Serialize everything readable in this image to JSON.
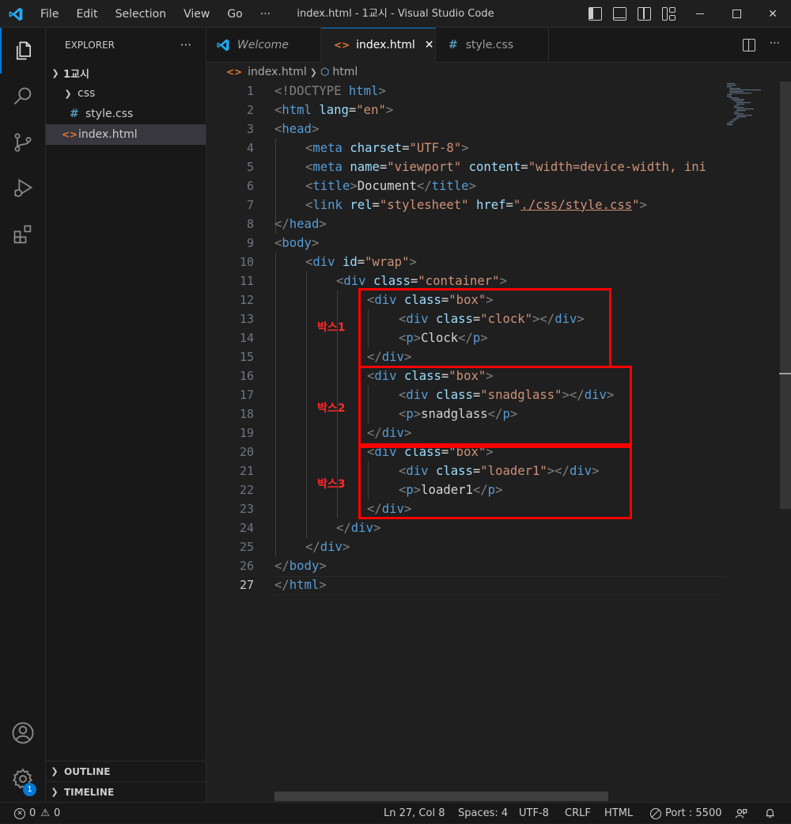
{
  "window": {
    "title": "index.html - 1교시 - Visual Studio Code"
  },
  "menu": [
    "File",
    "Edit",
    "Selection",
    "View",
    "Go",
    "···"
  ],
  "explorer": {
    "header": "EXPLORER",
    "more": "···",
    "root": "1교시",
    "folder": "css",
    "files": [
      "style.css",
      "index.html"
    ],
    "outline": "OUTLINE",
    "timeline": "TIMELINE"
  },
  "tabs": [
    {
      "label": "Welcome",
      "icon": "vscode-logo-icon"
    },
    {
      "label": "index.html",
      "icon": "html-file-icon",
      "close": "✕"
    },
    {
      "label": "style.css",
      "icon": "css-file-icon"
    }
  ],
  "editor_actions": {
    "more": "···"
  },
  "breadcrumb": {
    "file": "index.html",
    "symbol": "html"
  },
  "code_lines": [
    "1",
    "2",
    "3",
    "4",
    "5",
    "6",
    "7",
    "8",
    "9",
    "10",
    "11",
    "12",
    "13",
    "14",
    "15",
    "16",
    "17",
    "18",
    "19",
    "20",
    "21",
    "22",
    "23",
    "24",
    "25",
    "26",
    "27"
  ],
  "code": {
    "l1": [
      "<!DOCTYPE",
      " html",
      ">"
    ],
    "l2": [
      "<",
      "html",
      " lang",
      "=",
      "\"en\"",
      ">"
    ],
    "l3": [
      "<",
      "head",
      ">"
    ],
    "l4": [
      "<",
      "meta",
      " charset",
      "=",
      "\"UTF-8\"",
      ">"
    ],
    "l5": [
      "<",
      "meta",
      " name",
      "=",
      "\"viewport\"",
      " content",
      "=",
      "\"width=device-width, ini"
    ],
    "l6": [
      "<",
      "title",
      ">",
      "Document",
      "</",
      "title",
      ">"
    ],
    "l7": [
      "<",
      "link",
      " rel",
      "=",
      "\"stylesheet\"",
      " href",
      "=",
      "\"",
      "./css/style.css",
      "\"",
      ">"
    ],
    "l8": [
      "</",
      "head",
      ">"
    ],
    "l9": [
      "<",
      "body",
      ">"
    ],
    "l10": [
      "<",
      "div",
      " id",
      "=",
      "\"wrap\"",
      ">"
    ],
    "l11": [
      "<",
      "div",
      " class",
      "=",
      "\"container\"",
      ">"
    ],
    "l12": [
      "<",
      "div",
      " class",
      "=",
      "\"box\"",
      ">"
    ],
    "l13": [
      "<",
      "div",
      " class",
      "=",
      "\"clock\"",
      "></",
      "div",
      ">"
    ],
    "l14": [
      "<",
      "p",
      ">",
      "Clock",
      "</",
      "p",
      ">"
    ],
    "l15": [
      "</",
      "div",
      ">"
    ],
    "l16": [
      "<",
      "div",
      " class",
      "=",
      "\"box\"",
      ">"
    ],
    "l17": [
      "<",
      "div",
      " class",
      "=",
      "\"snadglass\"",
      "></",
      "div",
      ">"
    ],
    "l18": [
      "<",
      "p",
      ">",
      "snadglass",
      "</",
      "p",
      ">"
    ],
    "l19": [
      "</",
      "div",
      ">"
    ],
    "l20": [
      "<",
      "div",
      " class",
      "=",
      "\"box\"",
      ">"
    ],
    "l21": [
      "<",
      "div",
      " class",
      "=",
      "\"loader1\"",
      "></",
      "div",
      ">"
    ],
    "l22": [
      "<",
      "p",
      ">",
      "loader1",
      "</",
      "p",
      ">"
    ],
    "l23": [
      "</",
      "div",
      ">"
    ],
    "l24": [
      "</",
      "div",
      ">"
    ],
    "l25": [
      "</",
      "div",
      ">"
    ],
    "l26": [
      "</",
      "body",
      ">"
    ],
    "l27": [
      "</",
      "html",
      ">"
    ]
  },
  "annotations": [
    "박스1",
    "박스2",
    "박스3"
  ],
  "annotation_color": "#ff0000",
  "statusbar": {
    "errors": "0",
    "warnings": "0",
    "position": "Ln 27, Col 8",
    "spaces": "Spaces: 4",
    "encoding": "UTF-8",
    "eol": "CRLF",
    "language": "HTML",
    "port": "Port : 5500"
  },
  "settings_badge": "1",
  "colors": {
    "accent": "#0078d4",
    "tag": "#569cd6",
    "attr": "#9cdcfe",
    "string": "#ce9178"
  }
}
